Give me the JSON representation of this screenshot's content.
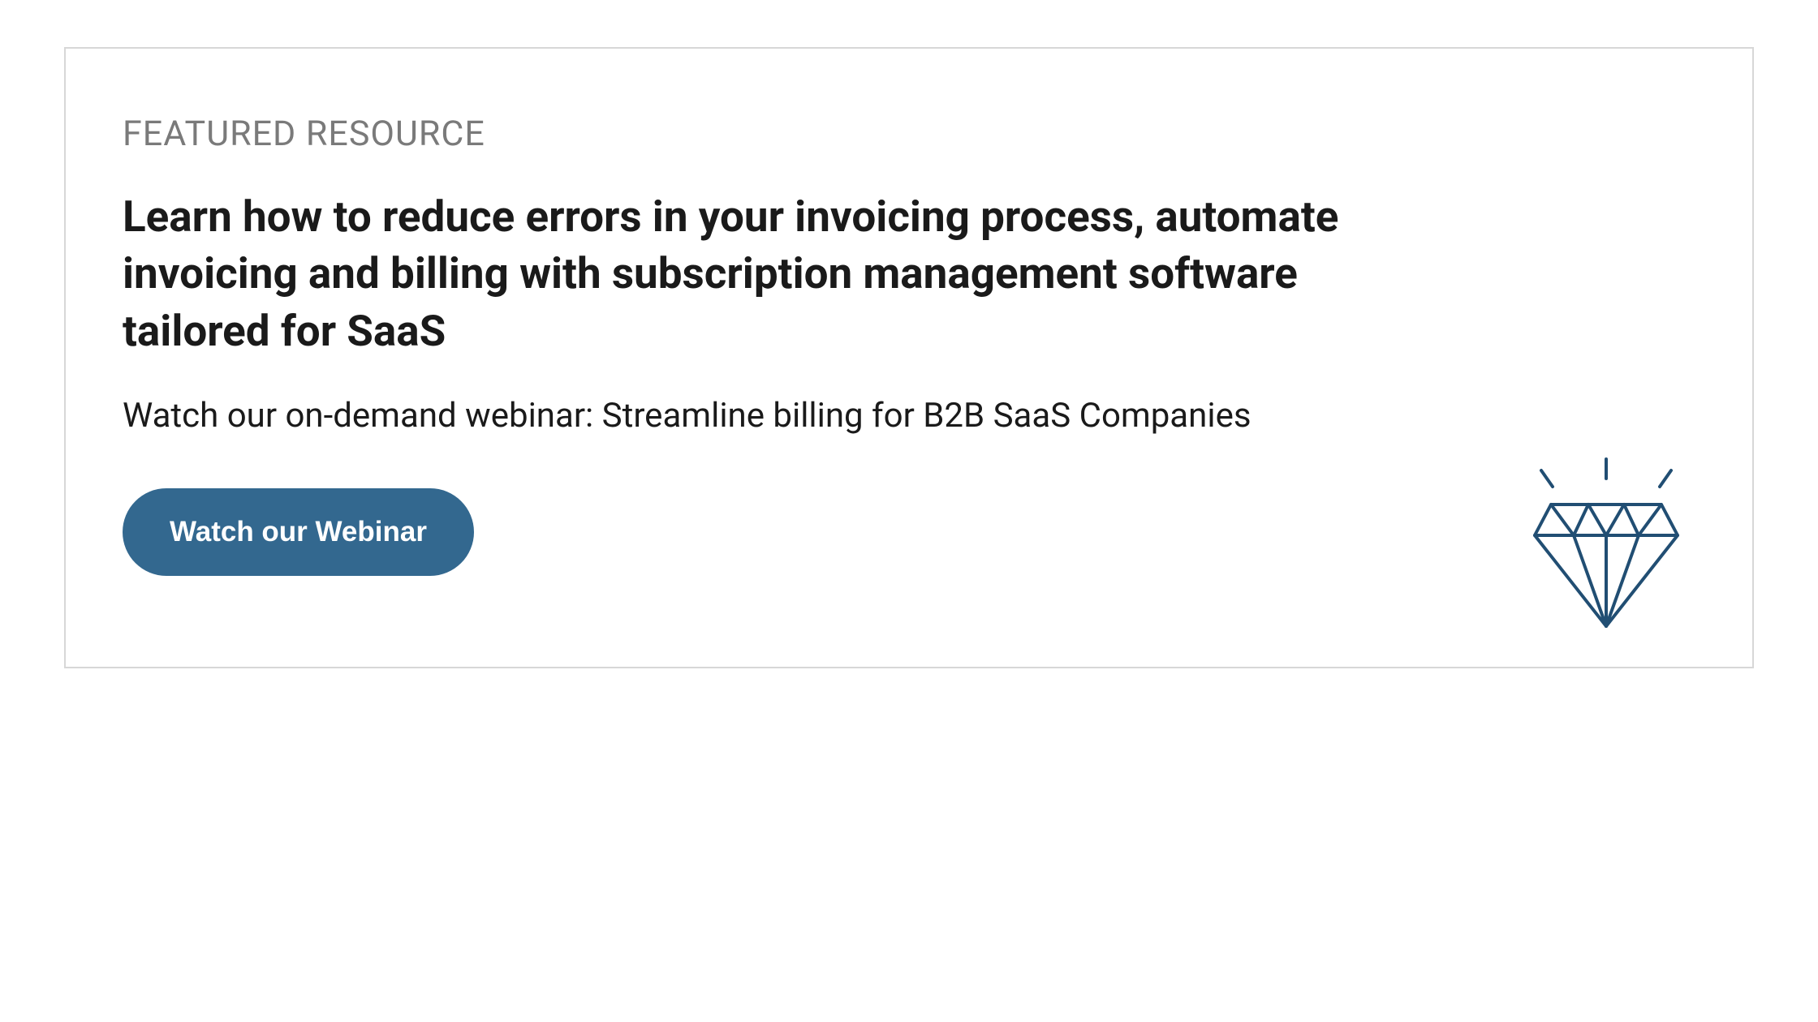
{
  "card": {
    "eyebrow": "FEATURED RESOURCE",
    "headline": "Learn how to reduce errors in your invoicing process, automate invoicing and billing with subscription management software tailored for SaaS",
    "subheading": "Watch our on-demand webinar: Streamline billing for B2B SaaS Companies",
    "cta_label": "Watch our Webinar"
  },
  "colors": {
    "eyebrow": "#7a7a7a",
    "text": "#1a1a1a",
    "button_bg": "#33688f",
    "button_fg": "#ffffff",
    "border": "#d7d7d7",
    "diamond_stroke": "#214e73"
  }
}
